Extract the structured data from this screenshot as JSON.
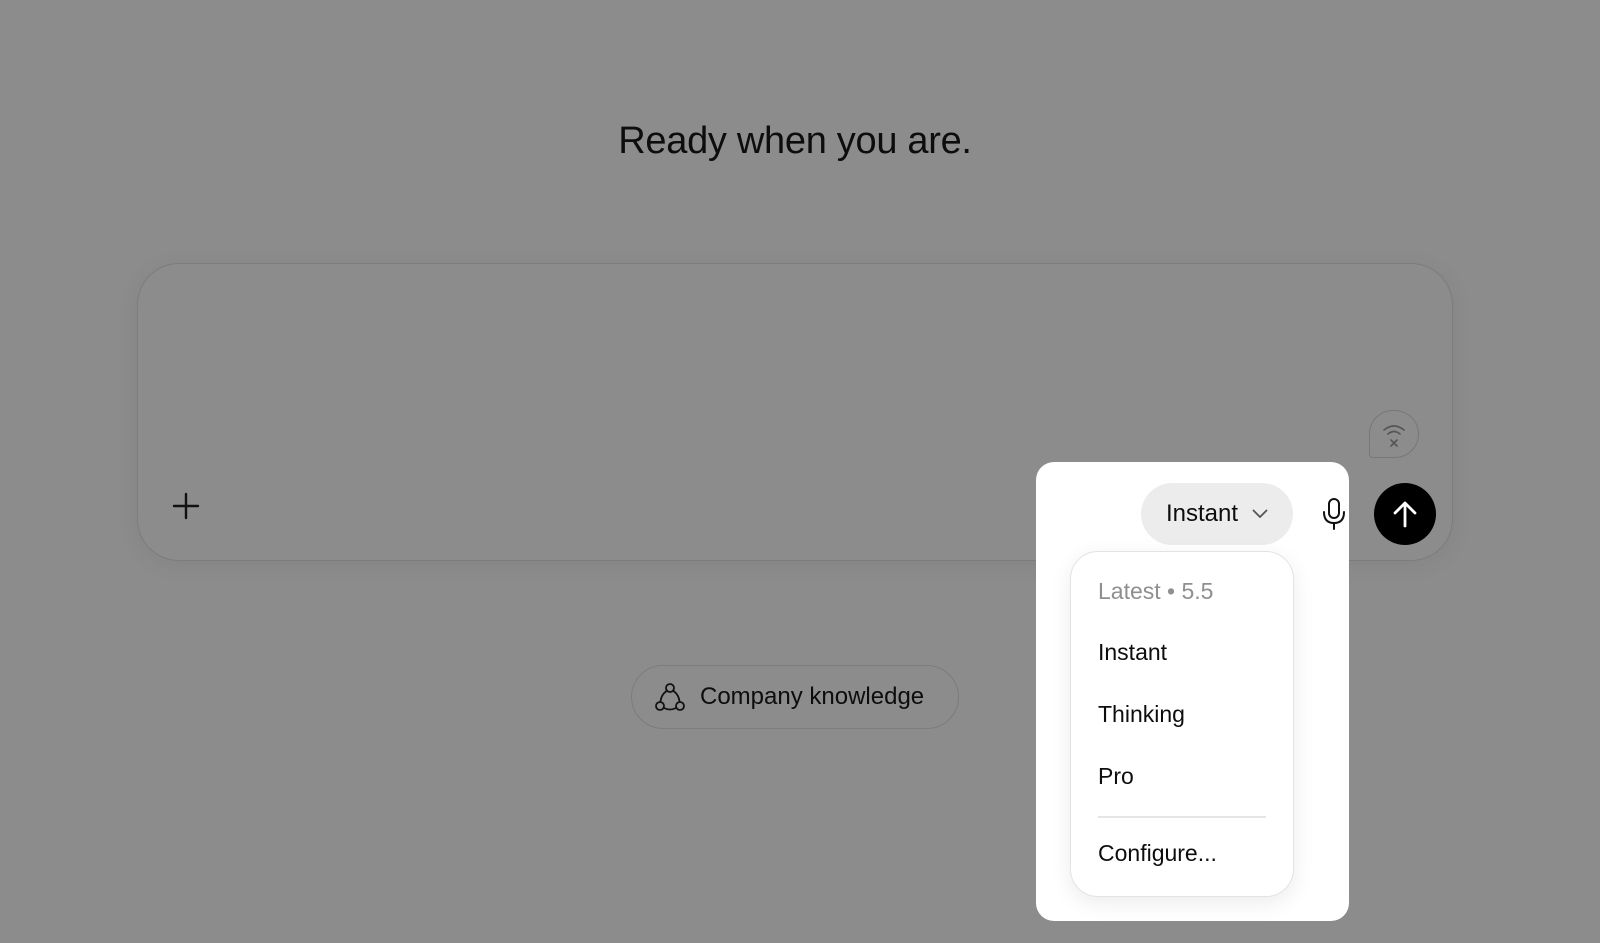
{
  "main": {
    "headline": "Ready when you are."
  },
  "composer": {
    "model_selector": {
      "selected": "Instant"
    }
  },
  "model_menu": {
    "header": "Latest • 5.5",
    "items": [
      {
        "label": "Instant"
      },
      {
        "label": "Thinking"
      },
      {
        "label": "Pro"
      }
    ],
    "configure_label": "Configure..."
  },
  "chips": {
    "company_knowledge": "Company knowledge"
  },
  "icons": {
    "add": "plus-icon",
    "connection": "wifi-off-icon",
    "model_chevron": "chevron-down-icon",
    "voice": "microphone-icon",
    "send": "arrow-up-icon",
    "knowledge": "connectors-icon"
  },
  "colors": {
    "overlay": "#8c8c8c",
    "surface": "#ffffff",
    "pill": "#ececec",
    "send_button": "#000000",
    "muted_text": "#8f8f8f"
  }
}
